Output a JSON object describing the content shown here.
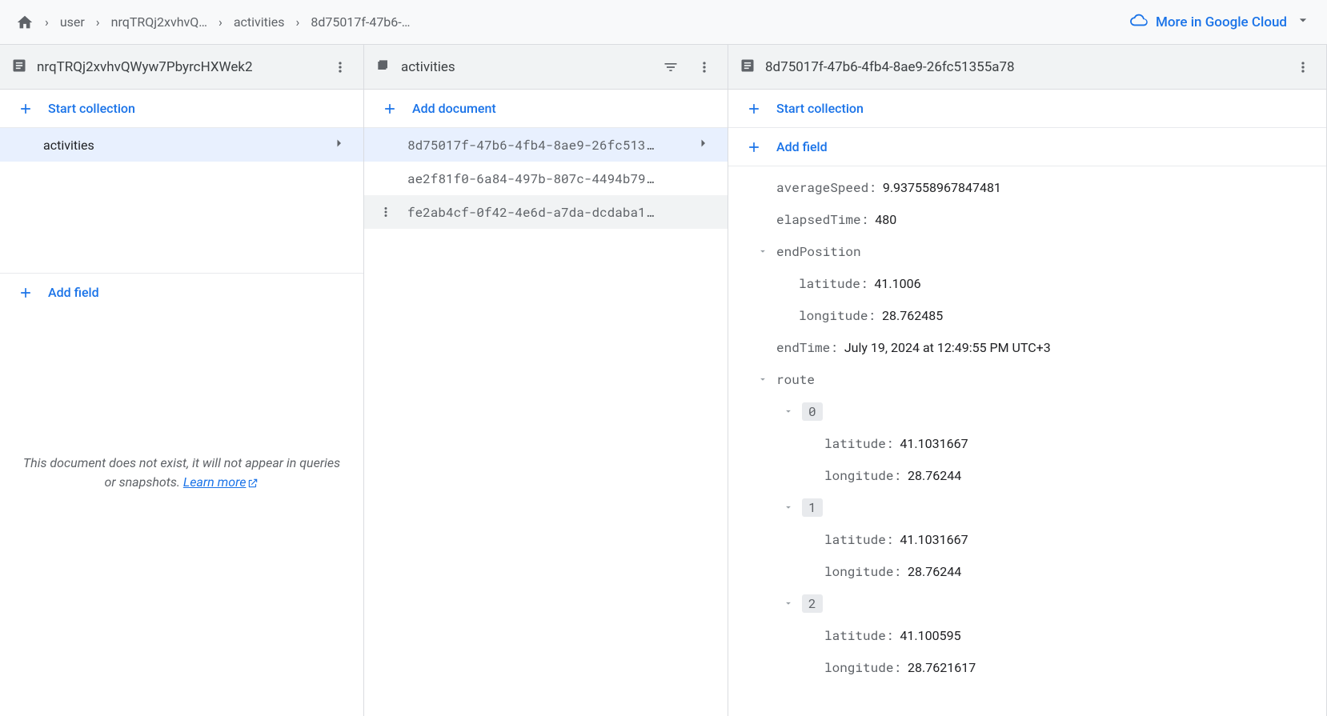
{
  "breadcrumbs": {
    "items": [
      "user",
      "nrqTRQj2xvhvQ…",
      "activities",
      "8d75017f-47b6-…"
    ]
  },
  "gcloud": {
    "label": "More in Google Cloud"
  },
  "doc_panel": {
    "title": "nrqTRQj2xvhvQWyw7PbyrcHXWek2",
    "start_collection": "Start collection",
    "collection_item": "activities",
    "add_field": "Add field",
    "empty_text": "This document does not exist, it will not appear in queries or snapshots. ",
    "learn_more": "Learn more"
  },
  "coll_panel": {
    "title": "activities",
    "add_document": "Add document",
    "docs": [
      "8d75017f-47b6-4fb4-8ae9-26fc513…",
      "ae2f81f0-6a84-497b-807c-4494b79…",
      "fe2ab4cf-0f42-4e6d-a7da-dcdaba1…"
    ]
  },
  "field_panel": {
    "title": "8d75017f-47b6-4fb4-8ae9-26fc51355a78",
    "start_collection": "Start collection",
    "add_field": "Add field",
    "fields": {
      "averageSpeed": {
        "key": "averageSpeed",
        "value": "9.937558967847481"
      },
      "elapsedTime": {
        "key": "elapsedTime",
        "value": "480"
      },
      "endPosition": {
        "key": "endPosition",
        "latitude": {
          "key": "latitude",
          "value": "41.1006"
        },
        "longitude": {
          "key": "longitude",
          "value": "28.762485"
        }
      },
      "endTime": {
        "key": "endTime",
        "value": "July 19, 2024 at 12:49:55 PM UTC+3"
      },
      "route": {
        "key": "route",
        "items": [
          {
            "idx": "0",
            "latitude": {
              "key": "latitude",
              "value": "41.1031667"
            },
            "longitude": {
              "key": "longitude",
              "value": "28.76244"
            }
          },
          {
            "idx": "1",
            "latitude": {
              "key": "latitude",
              "value": "41.1031667"
            },
            "longitude": {
              "key": "longitude",
              "value": "28.76244"
            }
          },
          {
            "idx": "2",
            "latitude": {
              "key": "latitude",
              "value": "41.100595"
            },
            "longitude": {
              "key": "longitude",
              "value": "28.7621617"
            }
          }
        ]
      }
    }
  }
}
